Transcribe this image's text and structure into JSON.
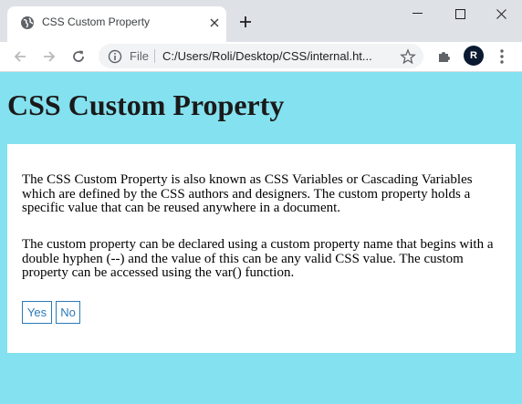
{
  "browser": {
    "tab": {
      "title": "CSS Custom Property"
    },
    "omnibox": {
      "scheme_label": "File",
      "url": "C:/Users/Roli/Desktop/CSS/internal.ht..."
    },
    "profile_initial": "R",
    "icons": {
      "favicon": "globe-icon",
      "close": "close-icon",
      "new_tab": "plus-icon",
      "minimize": "minimize-icon",
      "maximize": "maximize-icon",
      "window_close": "window-close-icon",
      "back": "back-arrow-icon",
      "forward": "forward-arrow-icon",
      "reload": "reload-icon",
      "info": "info-icon",
      "bookmark": "star-icon",
      "extensions": "puzzle-icon",
      "menu": "kebab-menu-icon"
    }
  },
  "page": {
    "heading": "CSS Custom Property",
    "paragraphs": [
      "The CSS Custom Property is also known as CSS Variables or Cascading Variables which are defined by the CSS authors and designers. The custom property holds a specific value that can be reused anywhere in a document.",
      "The custom property can be declared using a custom property name that begins with a double hyphen (--) and the value of this can be any valid CSS value. The custom property can be accessed using the var() function."
    ],
    "buttons": {
      "yes_label": "Yes",
      "no_label": "No"
    }
  },
  "colors": {
    "page_background": "#84e1ef",
    "content_background": "#ffffff",
    "button_accent": "#2a7ab8"
  }
}
